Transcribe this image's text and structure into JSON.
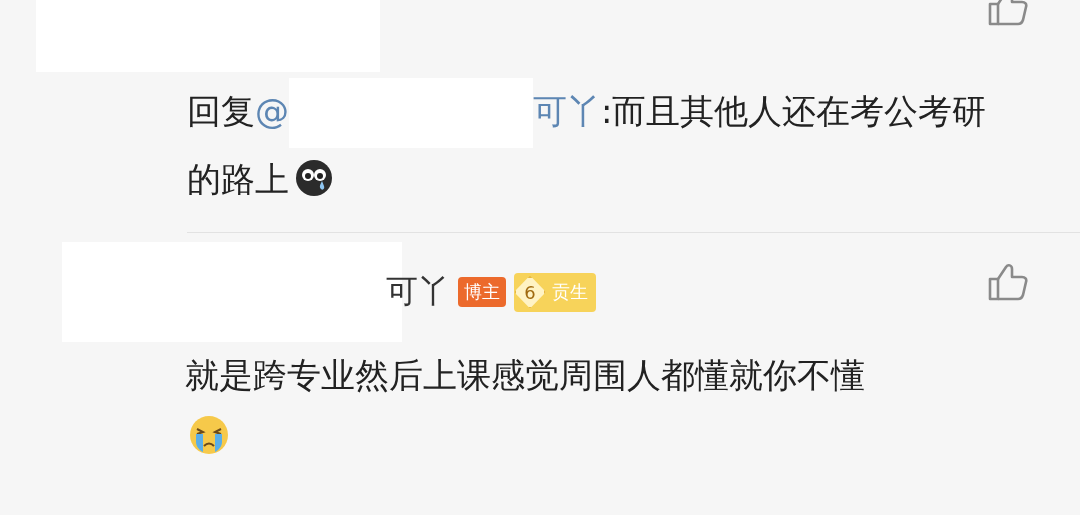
{
  "reply": {
    "prefix": "回复",
    "mention": "@",
    "mention_tail": "可丫",
    "text": ":而且其他人还在考公考研的路上"
  },
  "comment": {
    "author_tail": "可丫",
    "text": "就是跨专业然后上课感觉周围人都懂就你不懂",
    "badges": [
      {
        "kind": "role",
        "label": "博主"
      },
      {
        "kind": "rank",
        "level": "6",
        "label": "贡生"
      }
    ]
  }
}
